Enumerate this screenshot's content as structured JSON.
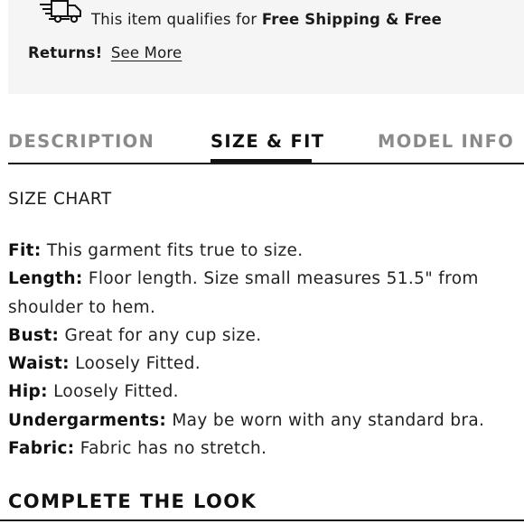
{
  "shipping": {
    "icon": "delivery-truck-icon",
    "text_prefix": "This item qualifies for ",
    "text_bold": "Free Shipping & Free",
    "text_bold_2": "Returns!",
    "link": "See More"
  },
  "tabs": [
    {
      "label": "DESCRIPTION",
      "active": false
    },
    {
      "label": "SIZE & FIT",
      "active": true
    },
    {
      "label": "MODEL INFO",
      "active": false
    }
  ],
  "content": {
    "heading": "SIZE CHART",
    "specs": [
      {
        "label": "Fit:",
        "value": " This garment fits true to size."
      },
      {
        "label": "Length:",
        "value": " Floor length. Size small measures 51.5\" from shoulder to hem."
      },
      {
        "label": "Bust:",
        "value": " Great for any cup size."
      },
      {
        "label": "Waist:",
        "value": " Loosely Fitted."
      },
      {
        "label": "Hip:",
        "value": " Loosely Fitted."
      },
      {
        "label": "Undergarments:",
        "value": " May be worn with any standard bra."
      },
      {
        "label": "Fabric:",
        "value": " Fabric has no stretch."
      }
    ]
  },
  "section_title": "COMPLETE THE LOOK",
  "colors": {
    "banner_bg": "#f5f5f5",
    "active_tab": "#111111",
    "inactive_tab": "#8a8a8a"
  }
}
